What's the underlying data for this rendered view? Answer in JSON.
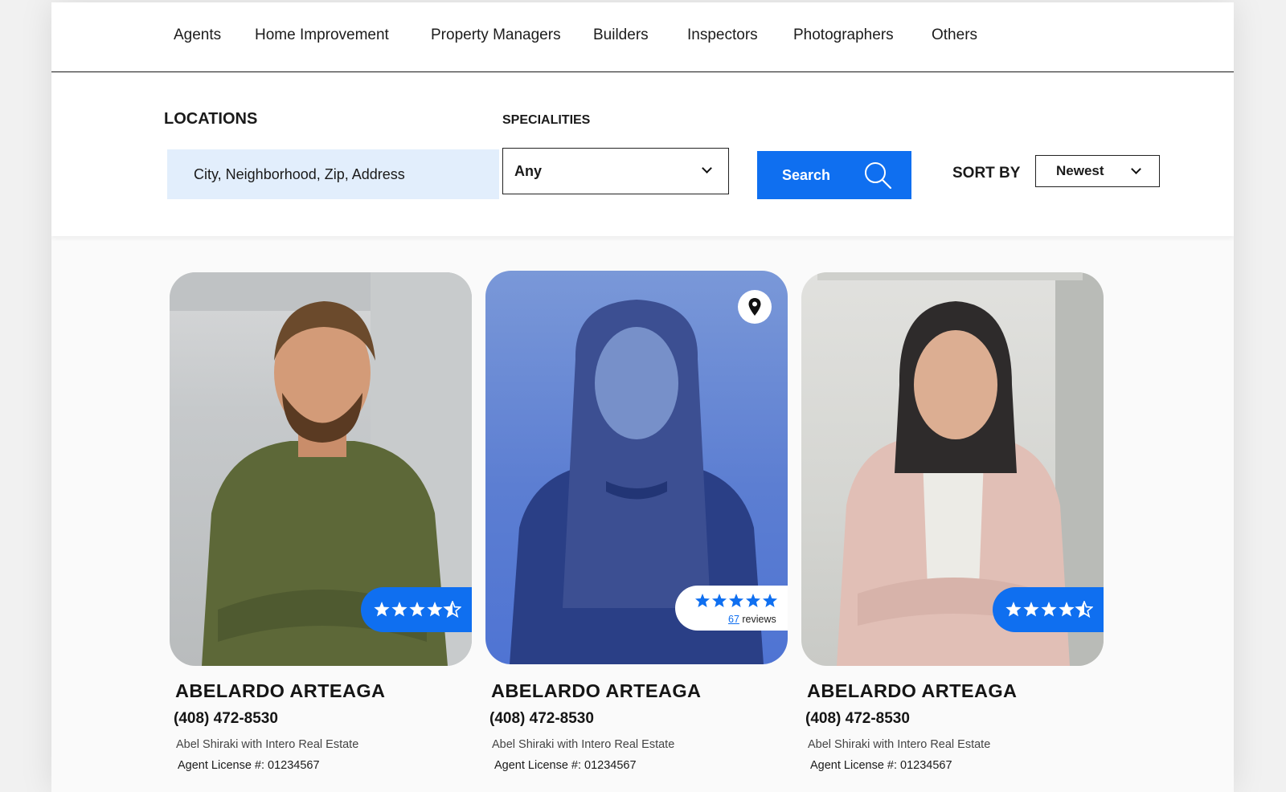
{
  "nav": {
    "items": [
      "Agents",
      "Home Improvement",
      "Property Managers",
      "Builders",
      "Inspectors",
      "Photographers",
      "Others"
    ]
  },
  "filters": {
    "locations_label": "LOCATIONS",
    "locations_placeholder": "City, Neighborhood, Zip, Address",
    "specialities_label": "SPECIALITIES",
    "specialities_value": "Any",
    "search_label": "Search",
    "sort_label": "SORT BY",
    "sort_value": "Newest"
  },
  "colors": {
    "accent": "#0f6ff0",
    "input_bg": "#e2eefc"
  },
  "cards": [
    {
      "name": "ABELARDO ARTEAGA",
      "phone": "(408) 472-8530",
      "company": "Abel Shiraki with Intero Real Estate",
      "license": "Agent License #: 01234567",
      "rating": 4.5
    },
    {
      "name": "ABELARDO ARTEAGA",
      "phone": "(408) 472-8530",
      "company": "Abel Shiraki with Intero Real Estate",
      "license": "Agent License #: 01234567",
      "rating": 5,
      "review_count": "67",
      "review_word": "reviews",
      "pin_icon": "location-pin-icon"
    },
    {
      "name": "ABELARDO ARTEAGA",
      "phone": "(408) 472-8530",
      "company": "Abel Shiraki with Intero Real Estate",
      "license": "Agent License #: 01234567",
      "rating": 4.5
    }
  ]
}
